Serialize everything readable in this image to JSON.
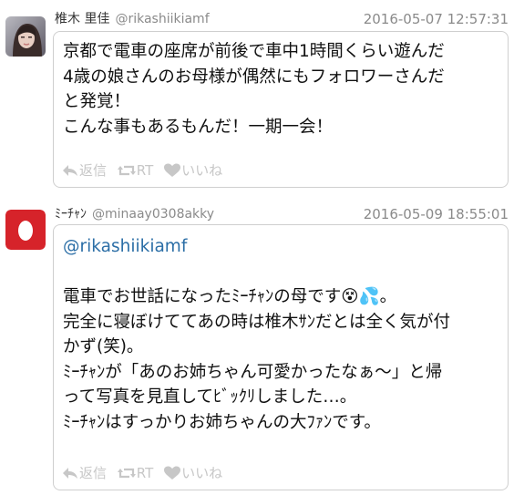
{
  "colors": {
    "handle_gray": "#8a8a8a",
    "mention_blue": "#2b6ea6",
    "action_gray": "#c7c7c7",
    "avatar2_red": "#d6232a"
  },
  "tweets": [
    {
      "display_name": "椎木 里佳",
      "handle": "@rikashiikiamf",
      "timestamp": "2016-05-07 12:57:31",
      "avatar_icon": "user-photo-avatar",
      "body_lines": [
        "京都で電車の座席が前後で車中1時間くらい遊んだ",
        "4歳の娘さんのお母様が偶然にもフォロワーさんだ",
        "と発覚！",
        "こんな事もあるもんだ！一期一会！"
      ],
      "actions": {
        "reply_icon": "reply-icon",
        "reply_label": "返信",
        "retweet_icon": "retweet-icon",
        "retweet_label": "RT",
        "like_icon": "heart-icon",
        "like_label": "いいね"
      }
    },
    {
      "display_name": "ﾐｰﾁｬﾝ",
      "handle": "@minaay0308akky",
      "timestamp": "2016-05-09 18:55:01",
      "avatar_icon": "egg-avatar",
      "mention": "@rikashiikiamf",
      "body_lines": [
        "電車でお世話になったﾐｰﾁｬﾝの母です😵💦。",
        "完全に寝ぼけててあの時は椎木ｻﾝだとは全く気が付",
        "かず(笑)。",
        "ﾐｰﾁｬﾝが「あのお姉ちゃん可愛かったなぁ〜」と帰",
        "って写真を見直してﾋﾞｯｸﾘしました…。",
        "ﾐｰﾁｬﾝはすっかりお姉ちゃんの大ﾌｧﾝです。"
      ],
      "actions": {
        "reply_icon": "reply-icon",
        "reply_label": "返信",
        "retweet_icon": "retweet-icon",
        "retweet_label": "RT",
        "like_icon": "heart-icon",
        "like_label": "いいね"
      }
    }
  ]
}
